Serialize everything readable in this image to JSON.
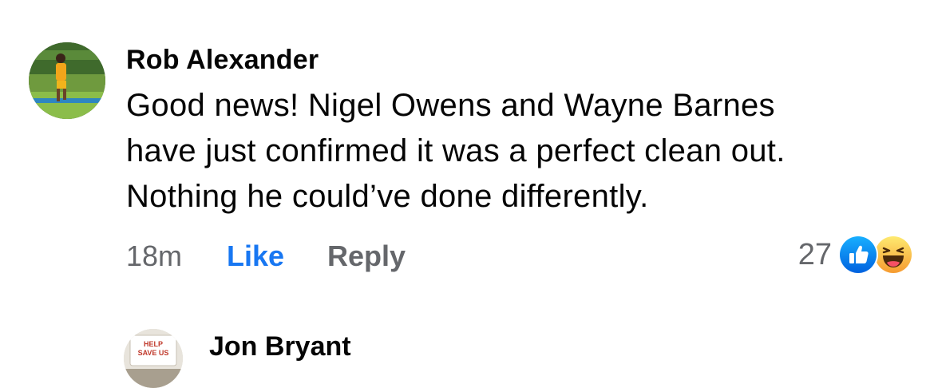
{
  "comment": {
    "author": "Rob Alexander",
    "lines": [
      "Good news! Nigel Owens and Wayne Barnes",
      "have just confirmed it was a perfect clean out.",
      "Nothing he could’ve done differently."
    ],
    "time": "18m",
    "like_label": "Like",
    "reply_label": "Reply",
    "reaction_count": "27",
    "reactions": [
      "like-icon",
      "haha-icon"
    ]
  },
  "next_comment": {
    "author": "Jon Bryant",
    "avatar_text": "HELP SAVE US"
  },
  "colors": {
    "link_blue": "#1877f2",
    "secondary_text": "#65676b",
    "primary_text": "#050505"
  }
}
